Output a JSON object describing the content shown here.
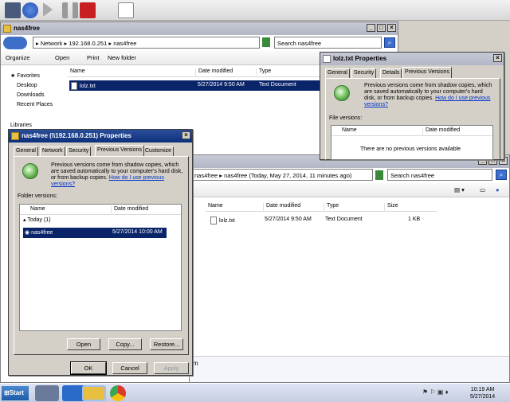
{
  "explorer": {
    "title": "nas4free",
    "address": [
      "Network",
      "192.168.0.251",
      "nas4free"
    ],
    "search_placeholder": "Search nas4free",
    "toolbar": {
      "organize": "Organize",
      "open": "Open",
      "print": "Print",
      "new_folder": "New folder"
    },
    "nav": {
      "favorites": "Favorites",
      "items": [
        "Desktop",
        "Downloads",
        "Recent Places"
      ],
      "libraries": "Libraries"
    },
    "columns": [
      "Name",
      "Date modified",
      "Type"
    ],
    "files": [
      {
        "name": "lolz.txt",
        "date": "5/27/2014 9:50 AM",
        "type": "Text Document"
      }
    ]
  },
  "file_props": {
    "title": "lolz.txt Properties",
    "tabs": [
      "General",
      "Security",
      "Details",
      "Previous Versions"
    ],
    "desc": "Previous versions come from shadow copies, which are saved automatically to your computer's hard disk, or from backup copies.",
    "link": "How do I use previous versions?",
    "file_versions_label": "File versions:",
    "columns": [
      "Name",
      "Date modified"
    ],
    "empty": "There are no previous versions available"
  },
  "shadow_win": {
    "address": [
      "nas4free",
      "nas4free (Today, May 27, 2014, 11 minutes ago)"
    ],
    "search_placeholder": "Search nas4free",
    "columns": [
      "Name",
      "Date modified",
      "Type",
      "Size"
    ],
    "files": [
      {
        "name": "lolz.txt",
        "date": "5/27/2014 9:50 AM",
        "type": "Text Document",
        "size": "1 KB"
      }
    ],
    "status": "m"
  },
  "folder_props": {
    "title": "nas4free (\\\\192.168.0.251) Properties",
    "tabs": [
      "General",
      "Network",
      "Security",
      "Previous Versions",
      "Customize"
    ],
    "desc": "Previous versions come from shadow copies, which are saved automatically to your computer's hard disk, or from backup copies.",
    "link": "How do I use previous versions?",
    "folder_versions_label": "Folder versions:",
    "columns": [
      "Name",
      "Date modified"
    ],
    "group": "Today (1)",
    "version": {
      "name": "nas4free",
      "date": "5/27/2014 10:00 AM"
    },
    "buttons": {
      "open": "Open",
      "copy": "Copy...",
      "restore": "Restore...",
      "ok": "OK",
      "cancel": "Cancel",
      "apply": "Apply"
    }
  },
  "taskbar": {
    "start": "Start",
    "time": "10:19 AM",
    "date": "5/27/2014"
  },
  "colors": {
    "titlebar_active": "#0b2f7a",
    "selection": "#0a246a",
    "link": "#0033cc"
  }
}
